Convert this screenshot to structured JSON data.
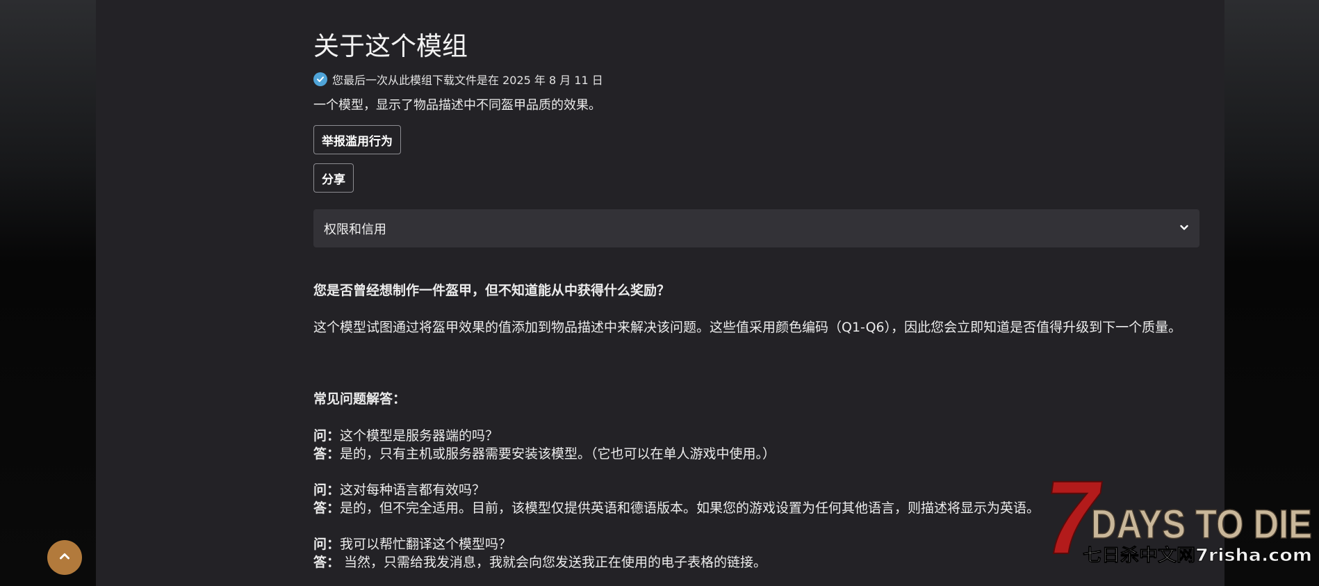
{
  "page": {
    "title": "关于这个模组",
    "download_note": "您最后一次从此模组下载文件是在 2025 年 8 月 11 日",
    "summary": "一个模型，显示了物品描述中不同盔甲品质的效果。"
  },
  "actions": {
    "report_label": "举报滥用行为",
    "share_label": "分享"
  },
  "accordion": {
    "label": "权限和信用",
    "icon": "chevron-down-icon"
  },
  "description": {
    "question": "您是否曾经想制作一件盔甲，但不知道能从中获得什么奖励？",
    "body": "这个模型试图通过将盔甲效果的值添加到物品描述中来解决该问题。这些值采用颜色编码（Q1-Q6），因此您会立即知道是否值得升级到下一个质量。"
  },
  "faq": {
    "heading": "常见问题解答：",
    "items": [
      {
        "q_label": "问：",
        "q": "这个模型是服务器端的吗？",
        "a_label": "答：",
        "a": "是的，只有主机或服务器需要安装该模型。（它也可以在单人游戏中使用。）"
      },
      {
        "q_label": "问：",
        "q": "这对每种语言都有效吗？",
        "a_label": "答：",
        "a": "是的，但不完全适用。目前，该模型仅提供英语和德语版本。如果您的游戏设置为任何其他语言，则描述将显示为英语。"
      },
      {
        "q_label": "问：",
        "q": "我可以帮忙翻译这个模型吗？",
        "a_label": "答：",
        "a": " 当然，只需给我发消息，我就会向您发送我正在使用的电子表格的链接。"
      }
    ]
  },
  "logo": {
    "title": "DAYS TO DIE",
    "numeral": "7",
    "subtitle": "七日杀中文网7risha.com"
  },
  "colors": {
    "accent": "#b27a3c",
    "panel": "#232226",
    "accordion": "#333237",
    "check": "#4fa4d8",
    "logo_red": "#b31b1b"
  }
}
